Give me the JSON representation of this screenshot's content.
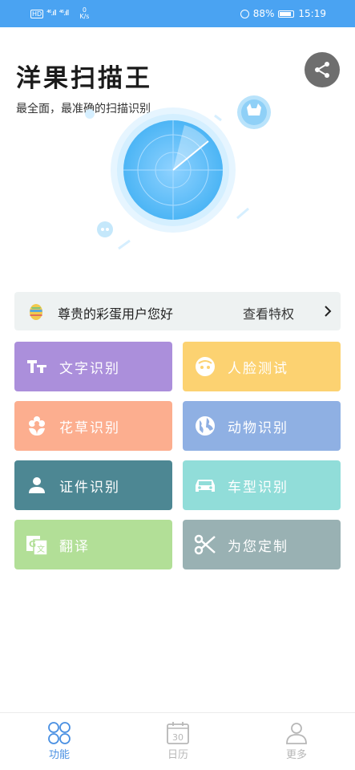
{
  "status_bar": {
    "left_badge": "HD",
    "signal_1": "⁴⁶.ıll",
    "signal_2": "⁴⁶.ıll",
    "speed_value": "0",
    "speed_unit": "K/s",
    "battery": "88%",
    "time": "15:19"
  },
  "header": {
    "title": "洋果扫描王",
    "subtitle": "最全面，最准确的扫描识别"
  },
  "vip_banner": {
    "greeting": "尊贵的彩蛋用户您好",
    "link": "查看特权"
  },
  "functions": [
    {
      "label": "文字识别",
      "color": "#ab8fdb",
      "icon": "text-tt-icon"
    },
    {
      "label": "人脸测试",
      "color": "#fcd271",
      "icon": "face-icon"
    },
    {
      "label": "花草识别",
      "color": "#fcae8f",
      "icon": "flower-icon"
    },
    {
      "label": "动物识别",
      "color": "#8fb0e3",
      "icon": "globe-icon"
    },
    {
      "label": "证件识别",
      "color": "#4d8793",
      "icon": "person-icon"
    },
    {
      "label": "车型识别",
      "color": "#91ddd9",
      "icon": "car-icon"
    },
    {
      "label": "翻译",
      "color": "#b2df97",
      "icon": "translate-icon"
    },
    {
      "label": "为您定制",
      "color": "#99b1b3",
      "icon": "scissors-icon"
    }
  ],
  "bottom_nav": {
    "items": [
      {
        "label": "功能",
        "active": true
      },
      {
        "label": "日历",
        "active": false
      },
      {
        "label": "更多",
        "active": false
      }
    ],
    "calendar_day": "30",
    "active_color": "#4a90e2",
    "inactive_color": "#b7b7b7"
  }
}
